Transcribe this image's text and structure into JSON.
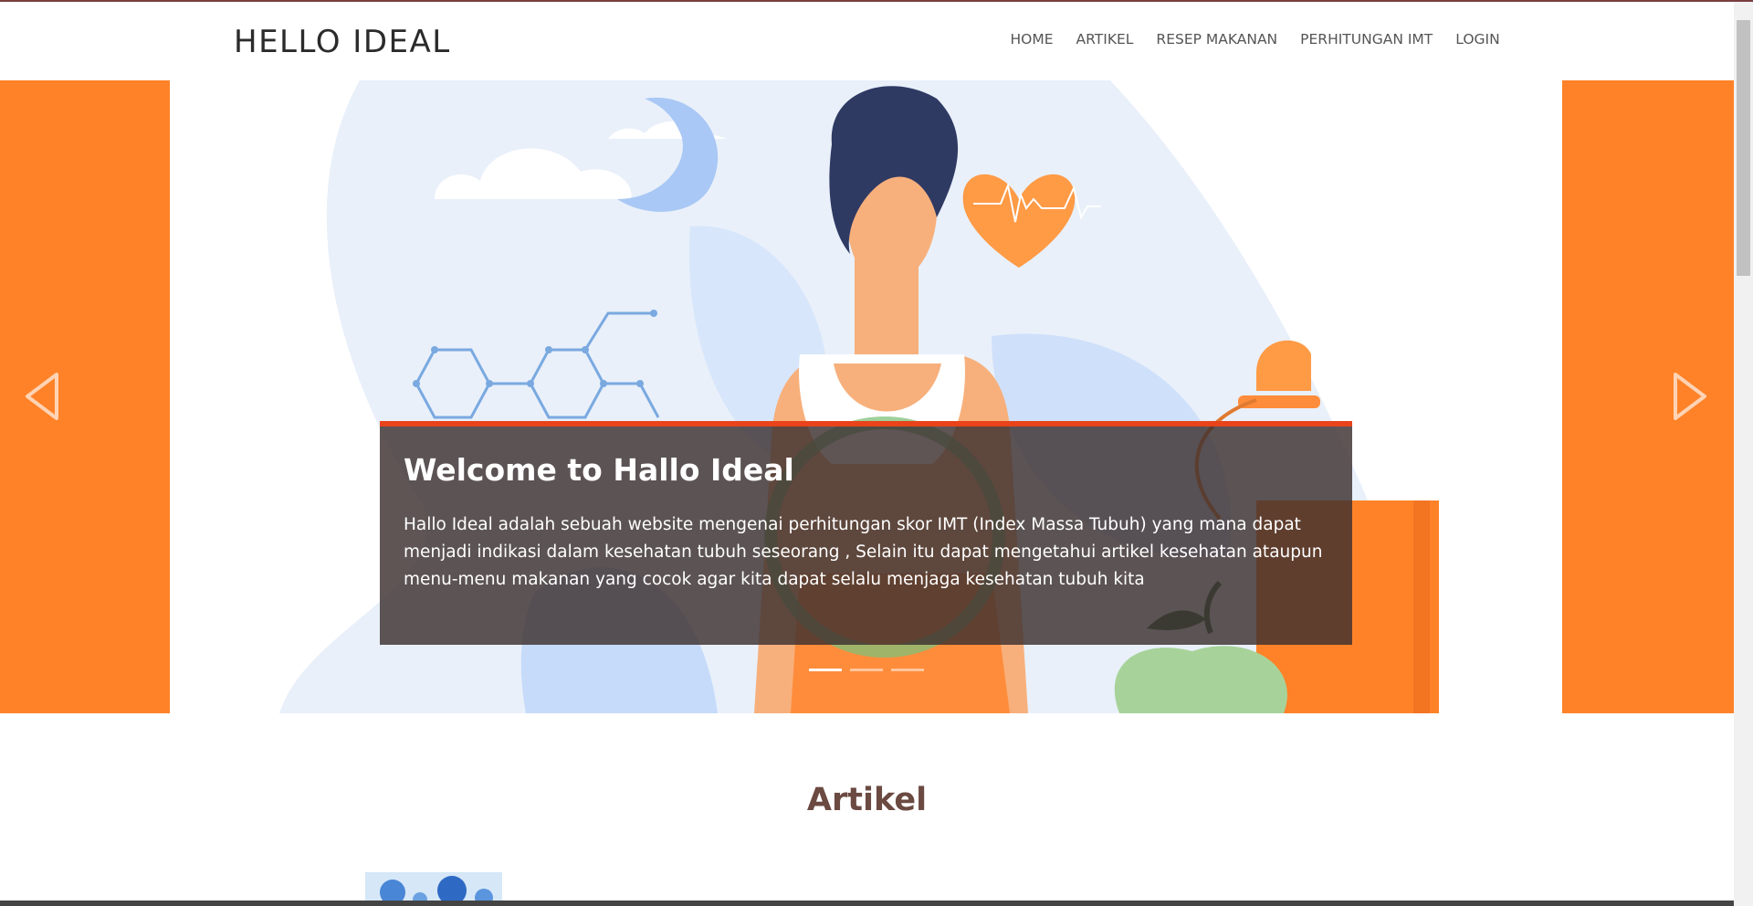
{
  "brand": "HELLO IDEAL",
  "nav": [
    "HOME",
    "ARTIKEL",
    "RESEP MAKANAN",
    "PERHITUNGAN IMT",
    "LOGIN"
  ],
  "carousel": {
    "caption_title": "Welcome to Hallo Ideal",
    "caption_text": "Hallo Ideal adalah sebuah website mengenai perhitungan skor IMT (Index Massa Tubuh) yang mana dapat menjadi indikasi dalam kesehatan tubuh seseorang , Selain itu dapat mengetahui artikel kesehatan ataupun menu-menu makanan yang cocok agar kita dapat selalu menjaga kesehatan tubuh kita",
    "slide_count": 3,
    "active_slide": 1,
    "prev_icon": "triangle-left-icon",
    "next_icon": "triangle-right-icon"
  },
  "section": {
    "title": "Artikel"
  },
  "colors": {
    "accent": "#ff8228",
    "caption_border": "#e8431a",
    "caption_bg": "#3c3030",
    "section_title": "#6b4a42"
  }
}
